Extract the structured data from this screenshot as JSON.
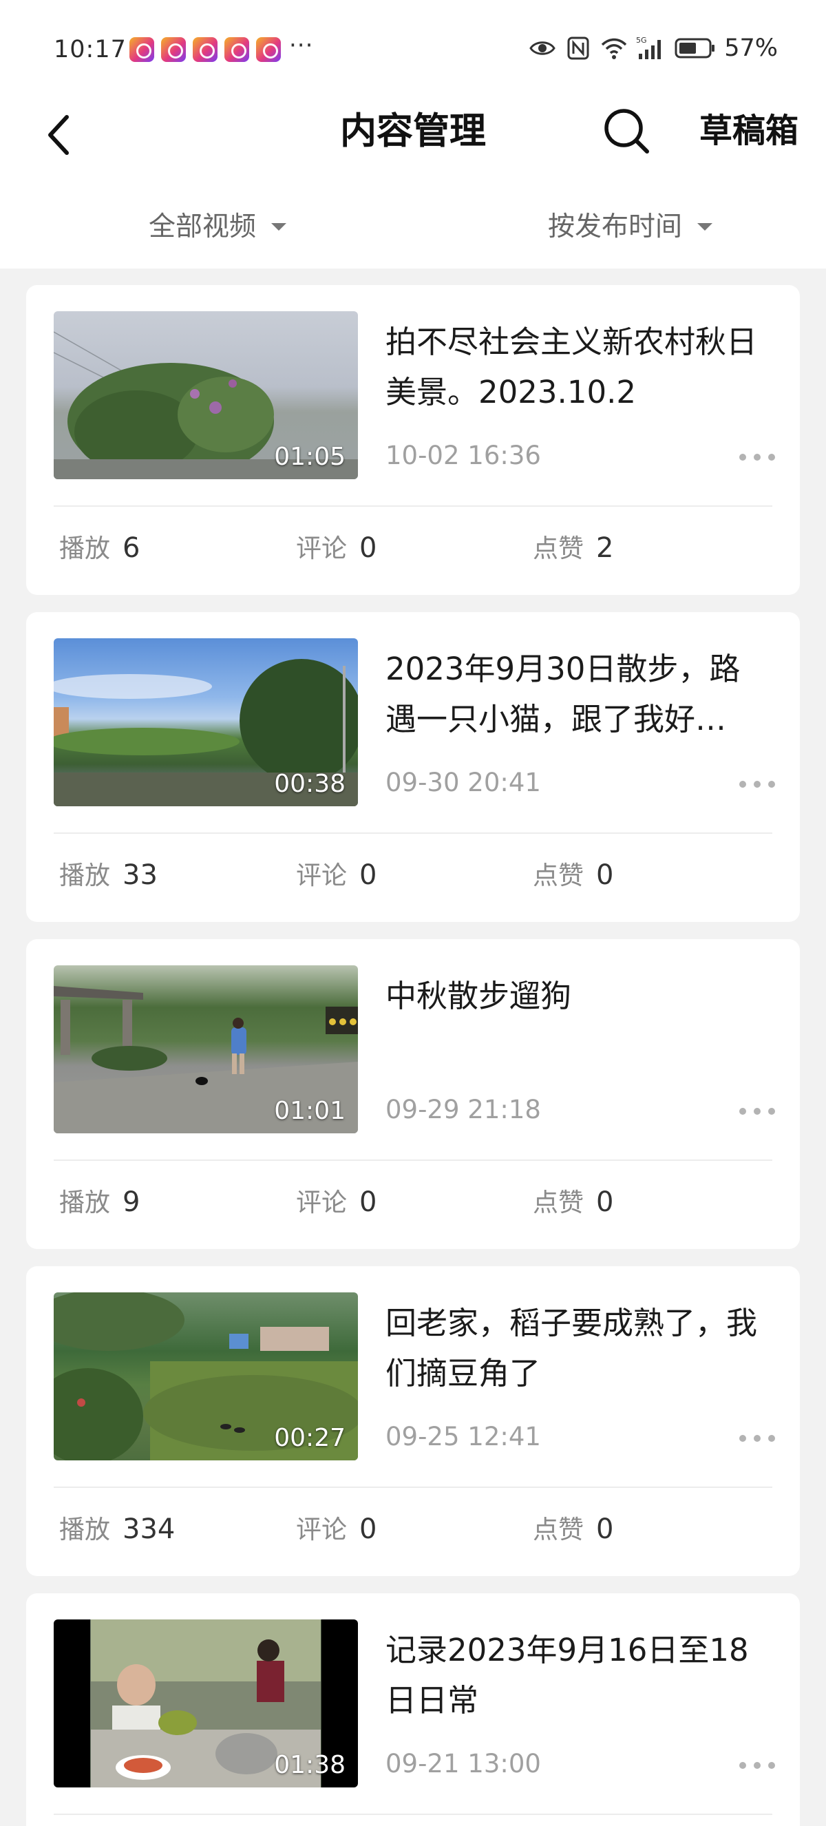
{
  "status_bar": {
    "time": "10:17",
    "more": "···",
    "battery": "57%"
  },
  "nav": {
    "title": "内容管理",
    "drafts": "草稿箱"
  },
  "filters": {
    "category": "全部视频",
    "sort": "按发布时间"
  },
  "labels": {
    "play": "播放",
    "comment": "评论",
    "like": "点赞"
  },
  "videos": [
    {
      "title": "拍不尽社会主义新农村秋日美景。2023.10.2",
      "duration": "01:05",
      "date": "10-02 16:36",
      "plays": "6",
      "comments": "0",
      "likes": "2"
    },
    {
      "title": "2023年9月30日散步，路遇一只小猫，跟了我好…",
      "duration": "00:38",
      "date": "09-30 20:41",
      "plays": "33",
      "comments": "0",
      "likes": "0"
    },
    {
      "title": "中秋散步遛狗",
      "duration": "01:01",
      "date": "09-29 21:18",
      "plays": "9",
      "comments": "0",
      "likes": "0"
    },
    {
      "title": "回老家，稻子要成熟了，我们摘豆角了",
      "duration": "00:27",
      "date": "09-25 12:41",
      "plays": "334",
      "comments": "0",
      "likes": "0"
    },
    {
      "title": "记录2023年9月16日至18日日常",
      "duration": "01:38",
      "date": "09-21 13:00",
      "plays": "",
      "comments": "",
      "likes": ""
    }
  ]
}
